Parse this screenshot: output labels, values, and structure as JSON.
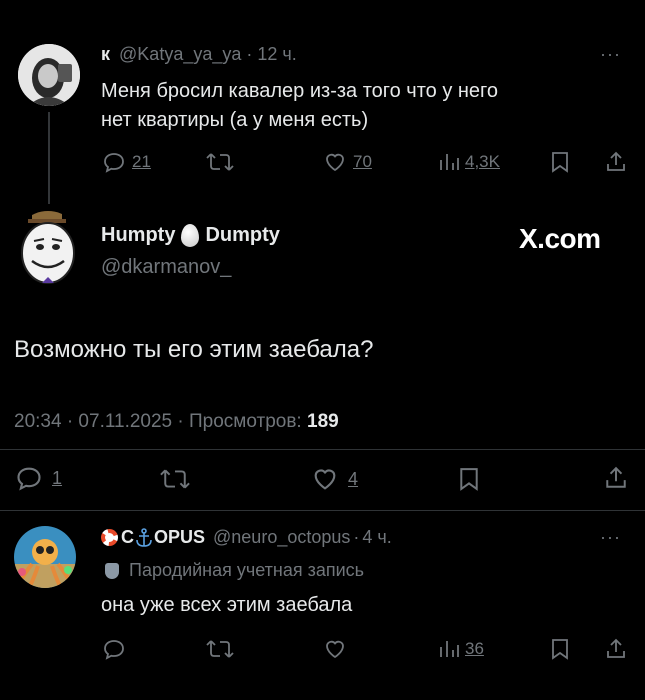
{
  "reply1": {
    "name": "к",
    "handle": "@Katya_ya_ya",
    "dot": "·",
    "time": "12 ч.",
    "text_line1": "Меня бросил кавалер из-за того что у него",
    "text_line2": "нет квартиры (а у меня есть)",
    "more": "···",
    "replies": "21",
    "likes": "70",
    "views": "4,3K"
  },
  "main": {
    "name_part1": "Humpty",
    "name_part2": "Dumpty",
    "handle": "@dkarmanov_",
    "watermark": "X.com",
    "text": "Возможно ты его этим заебала?",
    "meta_time": "20:34 · 07.11.2025 · Просмотров: ",
    "views": "189",
    "replies": "1",
    "likes": "4"
  },
  "reply2": {
    "name_prefix": "С",
    "name_suffix": "OPUS",
    "handle": "@neuro_octopus",
    "dot": "·",
    "time": "4 ч.",
    "parody_label": "Пародийная учетная запись",
    "text": "она уже всех этим заебала",
    "more": "···",
    "views": "36"
  },
  "colors": {
    "background": "#000000",
    "text": "#e7e9ea",
    "muted": "#71767b",
    "divider": "#2f3336"
  }
}
